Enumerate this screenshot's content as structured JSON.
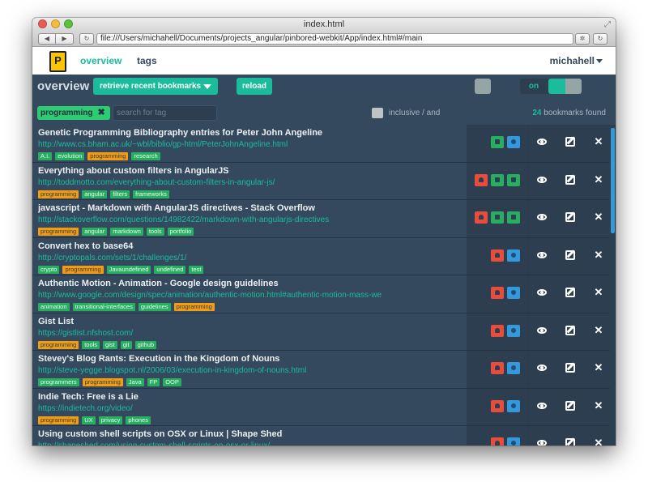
{
  "window": {
    "title": "index.html"
  },
  "browser": {
    "url": "file:///Users/michahell/Documents/projects_angular/pinbored-webkit/App/index.html#/main",
    "back_icon": "◀",
    "forward_icon": "▶",
    "refresh_icon": "↻",
    "settings_icon": "✲"
  },
  "app": {
    "logo_letter": "P",
    "nav": {
      "overview": "overview",
      "tags": "tags"
    },
    "user": "michahell"
  },
  "controls": {
    "title": "overview",
    "retrieve_label": "retrieve recent bookmarks",
    "reload_label": "reload",
    "switch_label": "on",
    "switch_on": true
  },
  "filter": {
    "active_tag": "programming",
    "remove_icon": "✖",
    "search_placeholder": "search for tag",
    "inclusive_label": "inclusive / and",
    "found_count": "24",
    "found_suffix": " bookmarks found"
  },
  "bookmarks": [
    {
      "title": "Genetic Programming Bibliography entries for Peter John Angeline",
      "url": "http://www.cs.bham.ac.uk/~wbl/biblio/gp-html/PeterJohnAngeline.html",
      "tags": [
        "A.I.",
        "evolution",
        "programming",
        "research"
      ],
      "status": [
        "green",
        "blue"
      ]
    },
    {
      "title": "Everything about custom filters in AngularJS",
      "url": "http://toddmotto.com/everything-about-custom-filters-in-angular-js/",
      "tags": [
        "programming",
        "angular",
        "filters",
        "frameworks"
      ],
      "status": [
        "red",
        "green",
        "green"
      ]
    },
    {
      "title": "javascript - Markdown with AngularJS directives - Stack Overflow",
      "url": "http://stackoverflow.com/questions/14982422/markdown-with-angularjs-directives",
      "tags": [
        "programming",
        "angular",
        "markdown",
        "tools",
        "portfolio"
      ],
      "status": [
        "red",
        "green",
        "green"
      ]
    },
    {
      "title": "Convert hex to base64",
      "url": "http://cryptopals.com/sets/1/challenges/1/",
      "tags": [
        "crypto",
        "programming",
        "Javaundefined",
        "undefined",
        "test"
      ],
      "status": [
        "red",
        "blue"
      ]
    },
    {
      "title": "Authentic Motion - Animation - Google design guidelines",
      "url": "http://www.google.com/design/spec/animation/authentic-motion.html#authentic-motion-mass-we",
      "tags": [
        "animation",
        "transitional-interfaces",
        "guidelines",
        "programming"
      ],
      "status": [
        "red",
        "blue"
      ]
    },
    {
      "title": "Gist List",
      "url": "https://gistlist.nfshost.com/",
      "tags": [
        "programming",
        "tools",
        "gist",
        "git",
        "github"
      ],
      "status": [
        "red",
        "blue"
      ]
    },
    {
      "title": "Stevey's Blog Rants: Execution in the Kingdom of Nouns",
      "url": "http://steve-yegge.blogspot.nl/2006/03/execution-in-kingdom-of-nouns.html",
      "tags": [
        "programmers",
        "programming",
        "Java",
        "FP",
        "OOP"
      ],
      "status": [
        "red",
        "blue"
      ]
    },
    {
      "title": "Indie Tech: Free is a Lie",
      "url": "https://indietech.org/video/",
      "tags": [
        "programming",
        "UX",
        "privacy",
        "phones"
      ],
      "status": [
        "red",
        "blue"
      ]
    },
    {
      "title": "Using custom shell scripts on OSX or Linux | Shape Shed",
      "url": "http://shapeshed.com/using-custom-shell-scripts-on-osx-or-linux/",
      "tags": [],
      "status": [
        "red",
        "blue"
      ]
    }
  ],
  "row_actions": {
    "view_icon": "eye-icon",
    "edit_icon": "edit-icon",
    "delete_icon": "✕"
  },
  "colors": {
    "accent": "#1abc9c",
    "programming_tag": "#f39c12",
    "tag": "#27ae60",
    "status_red": "#e74c3c",
    "status_green": "#27ae60",
    "status_blue": "#3498db"
  }
}
